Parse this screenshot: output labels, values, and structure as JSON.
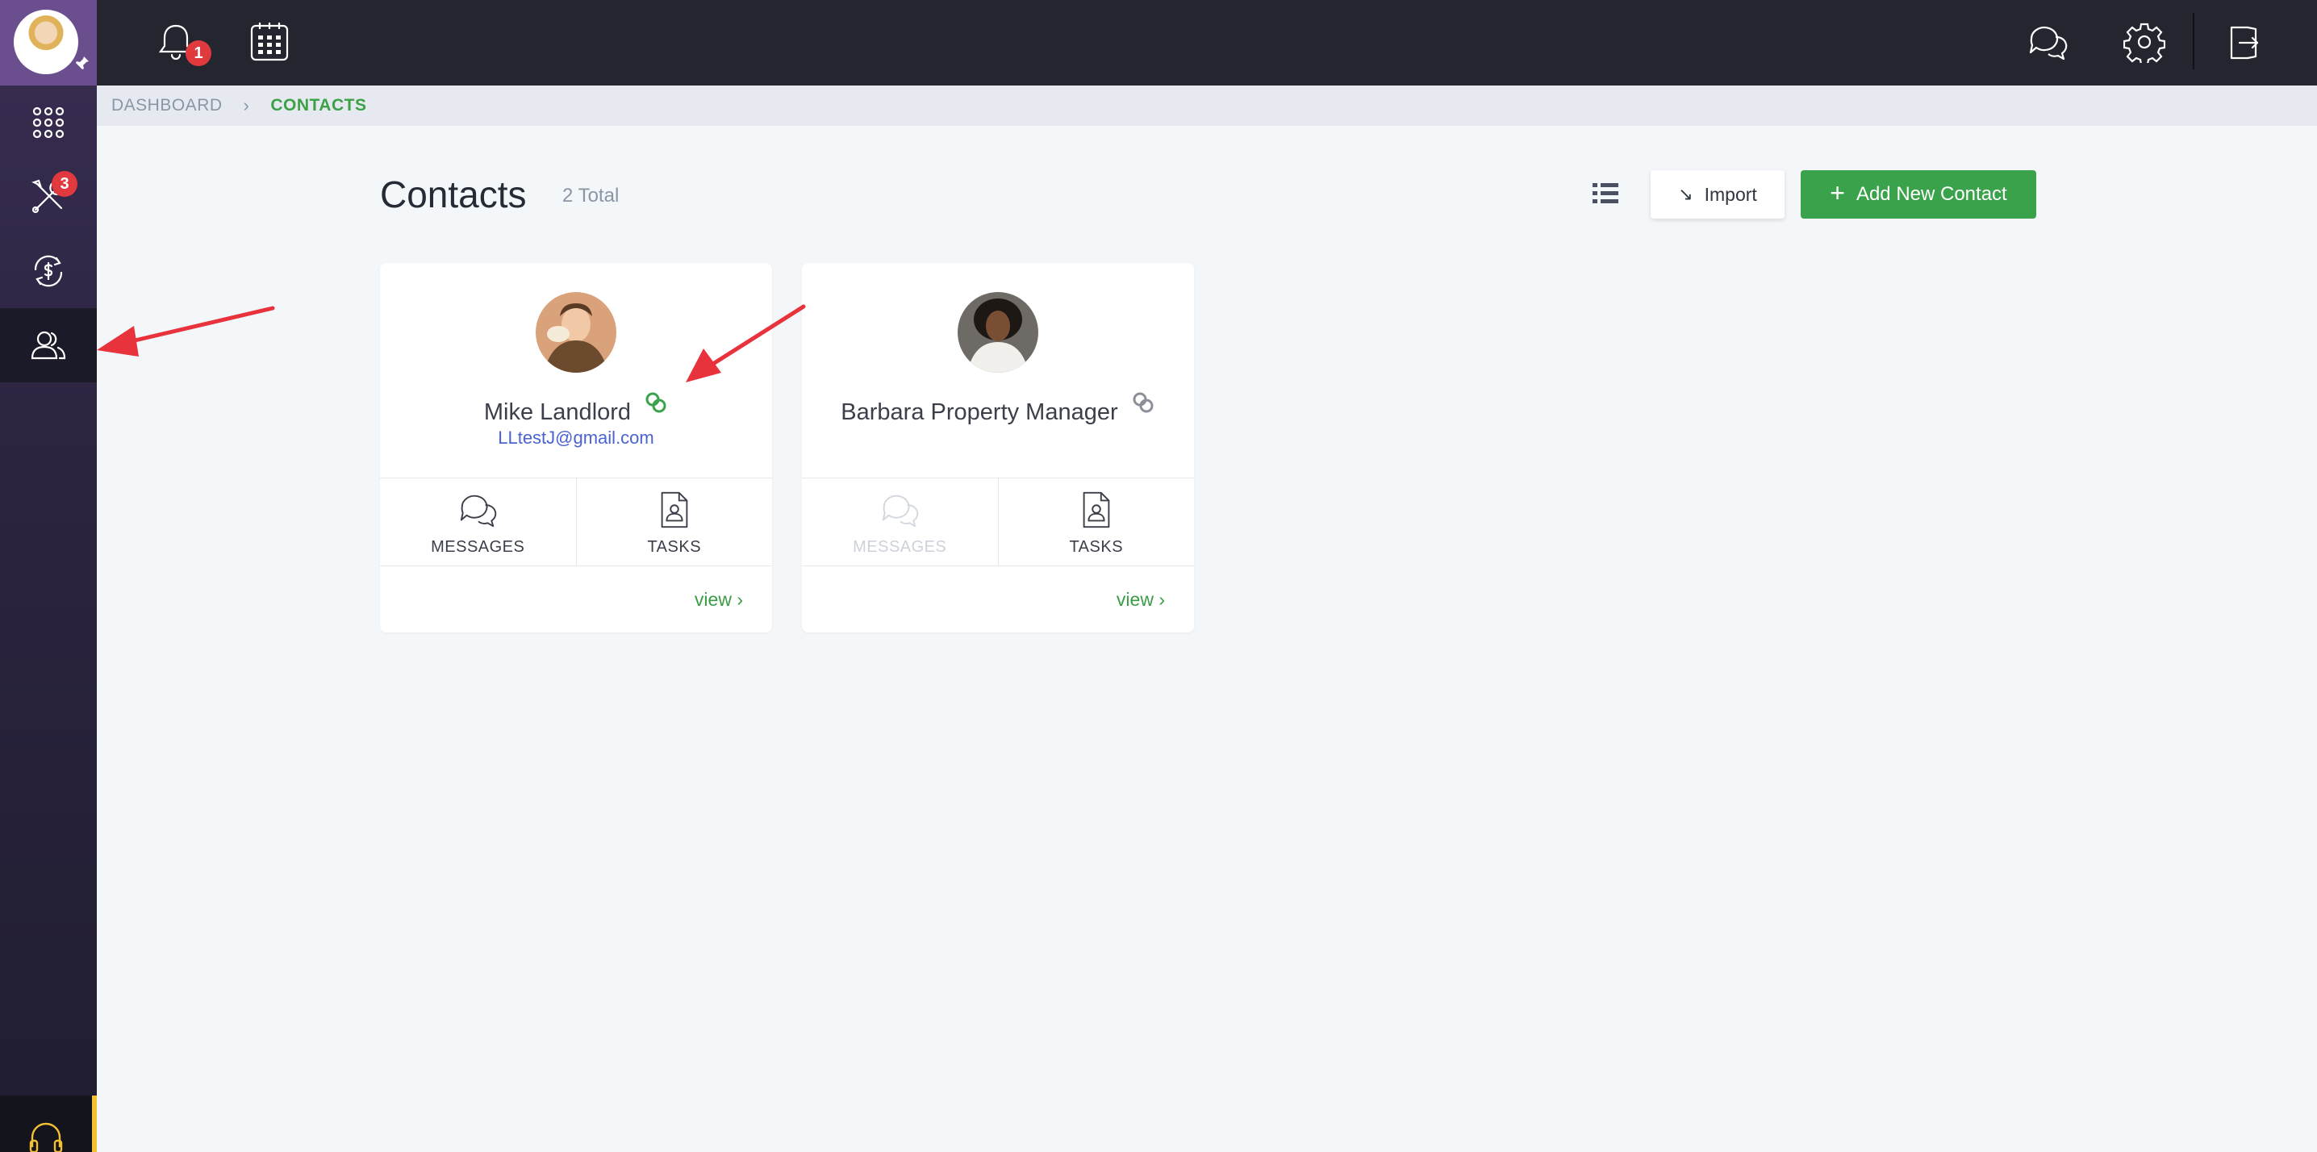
{
  "topbar": {
    "notification_count": "1",
    "icons": [
      "bell-icon",
      "calendar-icon",
      "chat-icon",
      "gear-icon",
      "logout-icon"
    ]
  },
  "sidebar": {
    "items": [
      {
        "icon": "apps-grid-icon"
      },
      {
        "icon": "tools-icon",
        "badge": "3"
      },
      {
        "icon": "payments-icon"
      },
      {
        "icon": "contacts-icon",
        "active": true
      }
    ],
    "help_icon": "headset-icon"
  },
  "breadcrumb": {
    "home": "DASHBOARD",
    "current": "CONTACTS"
  },
  "header": {
    "title": "Contacts",
    "total": "2 Total",
    "import_label": "Import",
    "add_label": "Add New Contact"
  },
  "contacts": [
    {
      "name": "Mike Landlord",
      "email": "LLtestJ@gmail.com",
      "linked": true,
      "messages_label": "MESSAGES",
      "tasks_label": "TASKS",
      "messages_enabled": true,
      "view_label": "view"
    },
    {
      "name": "Barbara Property Manager",
      "email": "",
      "linked": false,
      "messages_label": "MESSAGES",
      "tasks_label": "TASKS",
      "messages_enabled": false,
      "view_label": "view"
    }
  ],
  "colors": {
    "accent_green": "#3aa24a",
    "sidebar": "#2b2440",
    "topbar": "#23252f",
    "badge_red": "#e0393e",
    "link_blue": "#4a63d1",
    "annotation_red": "#e8323c"
  }
}
